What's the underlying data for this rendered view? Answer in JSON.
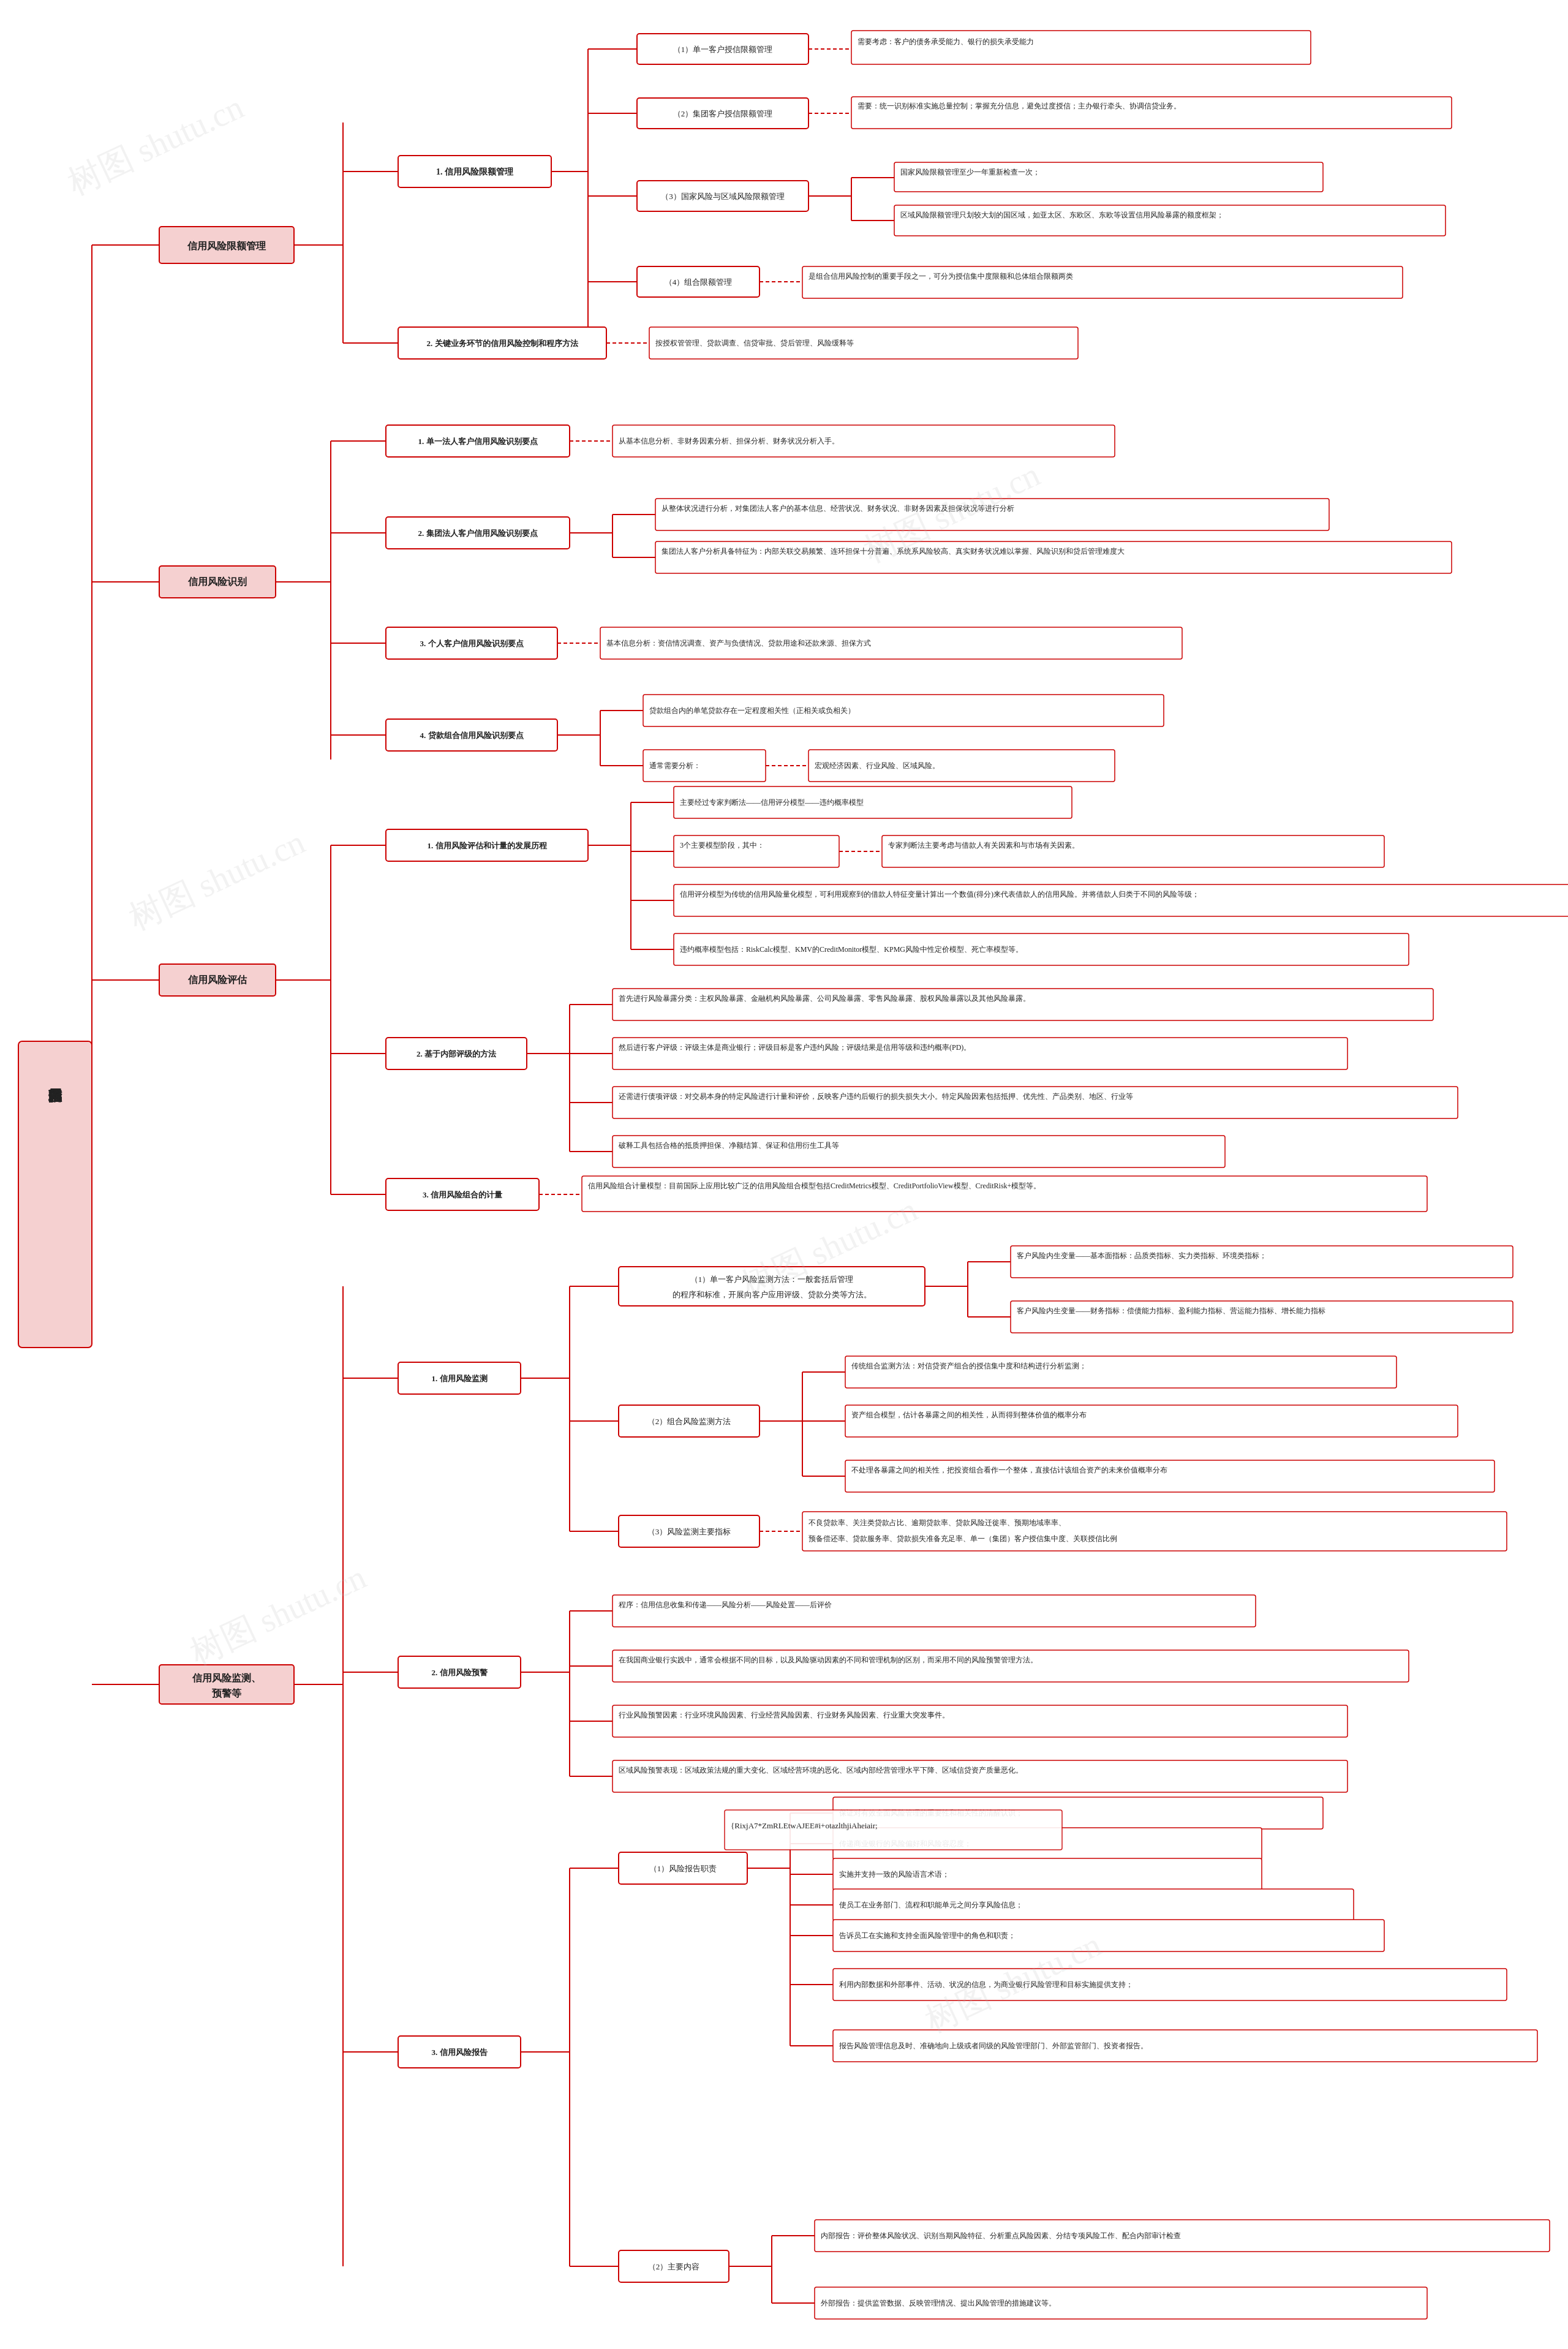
{
  "title": "风险管理信用风险",
  "watermark": "树图 shutu.cn",
  "sections": {
    "root": "风险管理信用风险",
    "l1_nodes": [
      {
        "id": "credit_limit",
        "label": "信用风险限额管理",
        "children": [
          {
            "id": "credit_limit_1",
            "label": "1. 信用风险限额管理",
            "children": [
              {
                "id": "cl1_1",
                "label": "（1）单一客户授信限额管理",
                "content": "需要考虑：客户的债务承受能力、银行的损失承受能力"
              },
              {
                "id": "cl1_2",
                "label": "（2）集团客户授信限额管理",
                "content": "需要：统一识别标准实施总量控制；掌握充分信息，避免过度授信；主办银行牵头、协调信贷业务。"
              },
              {
                "id": "cl1_3",
                "label": "（3）国家风险与区域风险限额管理",
                "children": [
                  {
                    "label": "国家风险限额管理至少一年重新检查一次；"
                  },
                  {
                    "label": "区域风险限额管理只划较大划的国区域，如亚太区、东欧区、东欧等设置信用风险暴露的额度框架；"
                  }
                ]
              },
              {
                "id": "cl1_4",
                "label": "（4）组合限额管理",
                "content": "是组合信用风险控制的重要手段之一，可分为授信集中度限额和总体组合限额两类"
              }
            ]
          },
          {
            "id": "credit_limit_2",
            "label": "2. 关键业务环节的信用风险控制和程序方法",
            "content": "按授权管管理、贷款调查、信贷审批、贷后管理、风险缓释等"
          }
        ]
      },
      {
        "id": "credit_identify",
        "label": "信用风险识别",
        "children": [
          {
            "id": "ci_1",
            "label": "1. 单一法人客户信用风险识别要点",
            "content": "从基本信息分析、非财务因素分析、担保分析、财务状况分析入手。"
          },
          {
            "id": "ci_2",
            "label": "2. 集团法人客户信用风险识别要点",
            "children": [
              {
                "label": "从整体状况进行分析，对集团法人客户的基本信息、经营状况、财务状况、非财务因素及担保状况等进行分析"
              },
              {
                "label": "集团法人客户分析具备特征为：内部关联交易频繁、连环担保十分普遍、系统系风险较高、真实财务状况难以掌握、风险识别和贷后管理难度大"
              }
            ]
          },
          {
            "id": "ci_3",
            "label": "3. 个人客户信用风险识别要点",
            "content": "基本信息分析：资信情况调查、资产与负债情况、贷款用途和还款来源、担保方式"
          },
          {
            "id": "ci_4",
            "label": "4. 贷款组合信用风险识别要点",
            "children": [
              {
                "label": "贷款组合内的单笔贷款存在一定程度相关性（正相关或负相关）"
              },
              {
                "label": "通常需要分析：",
                "content": "宏观经济因素、行业风险、区域风险。"
              }
            ]
          }
        ]
      },
      {
        "id": "credit_assess",
        "label": "信用风险评估",
        "children": [
          {
            "id": "ca_1",
            "label": "1. 信用风险评估和计量的发展历程",
            "children": [
              {
                "label": "主要经过专家判断法——信用评分模型——违约概率模型"
              },
              {
                "label": "3个主要模型阶段，其中：",
                "content": "专家判断法主要考虑与借款人有关因素和与市场有关因素。"
              },
              {
                "label": "信用评分模型为传统的信用风险量化模型，可利用观察到的借款人特征变量计算出一个数值(得分)来代表借款人的信用风险。并将借款人归类于不同的风险等级；"
              },
              {
                "label": "违约概率模型包括：RiskCalc模型、KMV的CreditMonitor模型、KPMG风险中性定价模型、死亡率模型等。"
              }
            ]
          },
          {
            "id": "ca_2",
            "label": "2. 基于内部评级的方法",
            "children": [
              {
                "label": "首先进行风险暴露分类：主权风险暴露、金融机构风险暴露、公司风险暴露、零售风险暴露、股权风险暴露以及其他风险暴露。"
              },
              {
                "label": "然后进行客户评级：评级主体是商业银行；评级目标是客户违约风险；评级结果是信用等级和违约概率(PD)。"
              },
              {
                "label": "还需进行债项评级：对交易本身的特定风险进行计量和评价，反映客户违约后银行的损失损失大小。特定风险因素包括抵押、优先性、产品类别、地区、行业等"
              },
              {
                "label": "破释工具包括合格的抵质押担保、净额结算、保证和信用衍生工具等"
              }
            ]
          },
          {
            "id": "ca_3",
            "label": "3. 信用风险组合的计量",
            "content": "信用风险组合计量模型：目前国际上应用比较广泛的信用风险组合模型包括CreditMetrics模型、CreditPortfolioView模型、CreditRisk+模型等。"
          }
        ]
      },
      {
        "id": "credit_monitor",
        "label": "信用风险监测、预警等",
        "children": [
          {
            "id": "cm_1",
            "label": "1. 信用风险监测",
            "children": [
              {
                "id": "cm_1_1",
                "label": "（1）单一客户风险监测方法：一般套括后管理的程序和标准，开展向客户应用评级、贷款分类等方法。",
                "children": [
                  {
                    "label": "客户风险内生变量——基本面指标：品质类指标、实力类指标、环境类指标；"
                  },
                  {
                    "label": "客户风险内生变量——财务指标：偿债能力指标、盈利能力指标、营运能力指标、增长能力指标"
                  }
                ]
              },
              {
                "id": "cm_1_2",
                "label": "（2）组合风险监测方法",
                "children": [
                  {
                    "label": "传统组合监测方法：对信贷资产组合的授信集中度和结构进行分析监测；"
                  },
                  {
                    "label": "资产组合模型，估计各暴露之间的相关性，从而得到整体价值的概率分布"
                  },
                  {
                    "label": "不处理各暴露之间的相关性，把投资组合看作一个整体，直接估计该组合资产的未来价值概率分布"
                  }
                ]
              },
              {
                "id": "cm_1_3",
                "label": "（3）风险监测主要指标",
                "content": "不良贷款率、关注类贷款占比、逾期贷款率、贷款风险迁徙率、预期地域率率、预备偿还率、贷款服务率、贷款损失准备充足率、单一（集团）客户授信集中度、关联授信比例"
              }
            ]
          },
          {
            "id": "cm_2",
            "label": "2. 信用风险预警",
            "children": [
              {
                "label": "程序：信用信息收集和传递——风险分析——风险处置——后评价"
              },
              {
                "label": "在我国商业银行实践中，通常会根据不同的目标，以及风险驱动因素的不同和管理机制的区别，而采用不同的风险预警管理方法。"
              },
              {
                "label": "行业风险预警因素：行业环境风险因素、行业经营风险因素、行业财务风险因素、行业重大突发事件。"
              },
              {
                "label": "区域风险预警表现：区域政策法规的重大变化、区域经营环境的恶化、区域内部经营管理水平下降、区域信贷资产质量恶化。"
              }
            ]
          },
          {
            "id": "cm_3",
            "label": "3. 信用风险报告",
            "children": [
              {
                "id": "cm_3_1",
                "label": "（1）风险报告职责",
                "children": [
                  {
                    "label": "保证对有效全面风险管理的重要性和相关性的清醒认识；"
                  },
                  {
                    "label": "传递商业银行的风险偏好和风险容忍度；"
                  },
                  {
                    "label": "实施并支持一致的风险语言术语；"
                  },
                  {
                    "label": "使员工在业务部门、流程和职能单元之间分享风险信息；"
                  },
                  {
                    "label": "告诉员工在实施和支持全面风险管理中的角色和职责；"
                  },
                  {
                    "label": "利用内部数据和外部事件、活动、状况的信息，为商业银行风险管理和目标实施提供支持；"
                  },
                  {
                    "label": "报告风险管理信息及时、准确地向上级或者同级的风险管理部门、外部监管部门、投资者报告。"
                  }
                ]
              },
              {
                "id": "cm_3_2",
                "label": "（2）主要内容",
                "children": [
                  {
                    "label": "内部报告：评价整体风险状况、识别当期风险特征、分析重点风险因素、分结专项风险工作、配合内部审计检查"
                  },
                  {
                    "label": "外部报告：提供监管数据、反映管理情况、提出风险管理的措施建议等。"
                  }
                ]
              }
            ]
          }
        ]
      }
    ]
  },
  "colors": {
    "border": "#cc0000",
    "bg_light": "#f9e8e8",
    "text_dark": "#222222",
    "line": "#cc0000",
    "watermark": "#aaaaaa"
  }
}
